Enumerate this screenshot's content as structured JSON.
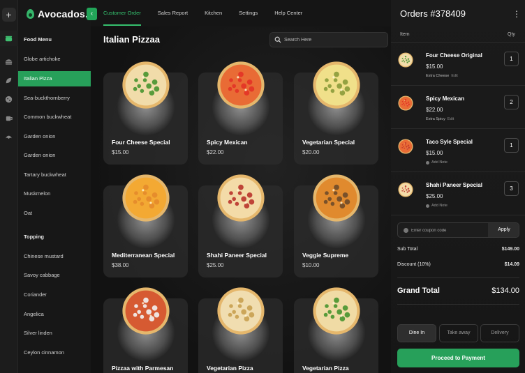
{
  "app": {
    "brand": "Avocados."
  },
  "topnav": {
    "tabs": [
      {
        "label": "Customer Order",
        "active": true
      },
      {
        "label": "Sales Report"
      },
      {
        "label": "Kitchen"
      },
      {
        "label": "Settings"
      },
      {
        "label": "Help Center"
      }
    ]
  },
  "rail": {
    "icons": [
      "plus-icon",
      "food-menu-icon",
      "burger-icon",
      "leaf-icon",
      "cookie-icon",
      "cup-icon",
      "croissant-icon"
    ]
  },
  "sidebar": {
    "food_menu_title": "Food Menu",
    "food_menu": [
      "Globe artichoke",
      "Italian Pizza",
      "Sea-buckthornberry",
      "Common buckwheat",
      "Garden onion",
      "Garden onion",
      "Tartary buckwheat",
      "Muskmelon",
      "Oat"
    ],
    "active_item": "Italian Pizza",
    "topping_title": "Topping",
    "toppings": [
      "Chinese mustard",
      "Savoy cabbage",
      "Coriander",
      "Angelica",
      "Silver linden",
      "Ceylon cinnamon"
    ]
  },
  "main": {
    "title": "Italian Pizzaa",
    "search_placeholder": "Search Here",
    "products": [
      {
        "name": "Four Cheese Special",
        "price": "$15.00",
        "sauce": "#f1dcaa",
        "top": "#47932f"
      },
      {
        "name": "Spicy Mexican",
        "price": "$22.00",
        "sauce": "#e96b35",
        "top": "#e33326"
      },
      {
        "name": "Vegetarian Special",
        "price": "$20.00",
        "sauce": "#f0e08a",
        "top": "#8a9b3a"
      },
      {
        "name": "Mediterranean Special",
        "price": "$38.00",
        "sauce": "#f3a933",
        "top": "#e48a2b"
      },
      {
        "name": "Shahi Paneer Special",
        "price": "$25.00",
        "sauce": "#f3dba8",
        "top": "#b9332b"
      },
      {
        "name": "Veggie Supreme",
        "price": "$10.00",
        "sauce": "#e08a2e",
        "top": "#6e4a2a"
      },
      {
        "name": "Pizzaa with Parmesan",
        "price": "",
        "sauce": "#d65a32",
        "top": "#f2f2f2"
      },
      {
        "name": "Vegetarian Pizza",
        "price": "",
        "sauce": "#f0ddb0",
        "top": "#c8a050"
      },
      {
        "name": "Vegetarian Pizza",
        "price": "",
        "sauce": "#f0dba5",
        "top": "#47932f"
      }
    ]
  },
  "order": {
    "title": "Orders #378409",
    "col_item": "Item",
    "col_qty": "Qty",
    "items": [
      {
        "name": "Four Cheese Original",
        "price": "$15.00",
        "note": "Extra Cheese",
        "edit": "Edit",
        "qty": "1",
        "sauce": "#f1dcaa",
        "top": "#47932f"
      },
      {
        "name": "Spicy Mexican",
        "price": "$22.00",
        "note": "Extra Spicy",
        "edit": "Edit",
        "qty": "2",
        "sauce": "#e96b35",
        "top": "#e33326"
      },
      {
        "name": "Taco Syle Special",
        "price": "$15.00",
        "add_note": "Add Note",
        "qty": "1",
        "sauce": "#e96b35",
        "top": "#c23a2a"
      },
      {
        "name": "Shahi Paneer Special",
        "price": "$25.00",
        "add_note": "Add Note",
        "qty": "3",
        "sauce": "#f3dba8",
        "top": "#b9332b"
      }
    ],
    "coupon_placeholder": "Enter coupon code",
    "apply_label": "Apply",
    "subtotal_label": "Sub Total",
    "subtotal": "$149.00",
    "discount_label": "Discount (10%)",
    "discount": "$14.09",
    "grand_label": "Grand Total",
    "grand": "$134.00",
    "modes": [
      {
        "label": "Dine In",
        "active": true
      },
      {
        "label": "Take away"
      },
      {
        "label": "Delivery"
      }
    ],
    "pay_label": "Proceed to Payment"
  }
}
